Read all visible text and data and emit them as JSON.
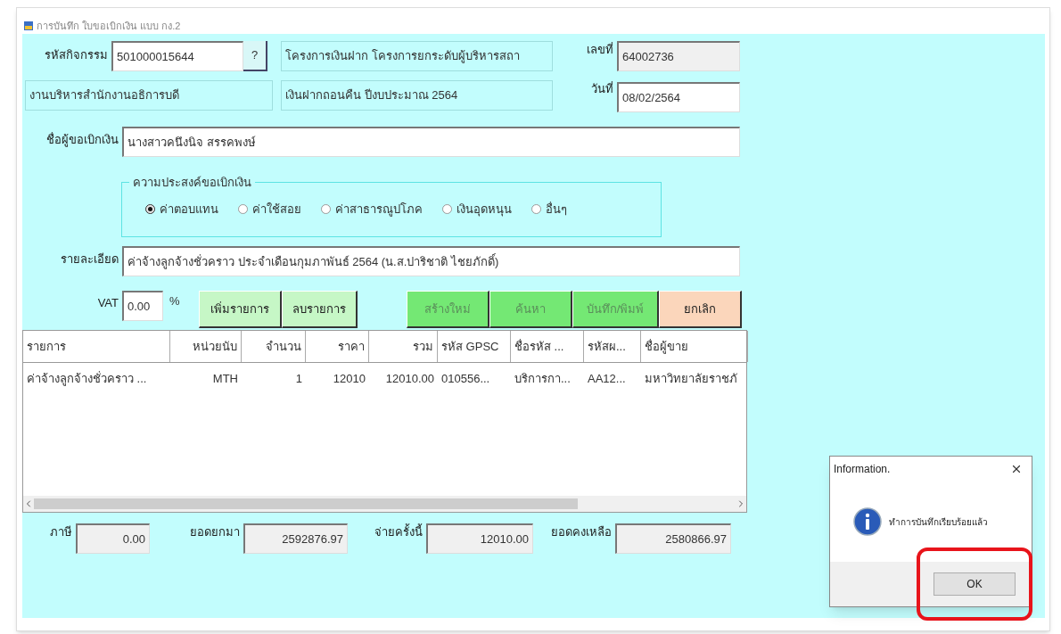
{
  "window": {
    "title": "การบันทึก ใบขอเบิกเงิน แบบ กง.2"
  },
  "header": {
    "activity_label": "รหัสกิจกรรม",
    "activity_code": "501000015644",
    "lookup_button": "?",
    "project": "โครงการเงินฝาก โครงการยกระดับผู้บริหารสถา",
    "number_label": "เลขที่",
    "number": "64002736",
    "department": "งานบริหารสำนักงานอธิการบดี",
    "budget": "เงินฝากถอนคืน ปีงบประมาณ 2564",
    "date_label": "วันที่",
    "date": "08/02/2564"
  },
  "requester": {
    "label": "ชื่อผู้ขอเบิกเงิน",
    "value": "นางสาวคนึงนิจ สรรคพงษ์"
  },
  "purpose": {
    "legend": "ความประสงค์ขอเบิกเงิน",
    "options": [
      {
        "label": "ค่าตอบแทน",
        "selected": true
      },
      {
        "label": "ค่าใช้สอย",
        "selected": false
      },
      {
        "label": "ค่าสาธารณูปโภค",
        "selected": false
      },
      {
        "label": "เงินอุดหนุน",
        "selected": false
      },
      {
        "label": "อื่นๆ",
        "selected": false
      }
    ]
  },
  "detail": {
    "label": "รายละเอียด",
    "value": "ค่าจ้างลูกจ้างชั่วคราว ประจำเดือนกุมภาพันธ์ 2564 (น.ส.ปาริชาติ ไชยภักดิ์)"
  },
  "vat": {
    "label": "VAT",
    "value": "0.00",
    "unit": "%"
  },
  "buttons": [
    {
      "label": "เพิ่มรายการ",
      "kind": "light",
      "disabled": false
    },
    {
      "label": "ลบรายการ",
      "kind": "light",
      "disabled": false
    },
    {
      "label": "สร้างใหม่",
      "kind": "green",
      "disabled": true
    },
    {
      "label": "ค้นหา",
      "kind": "green",
      "disabled": true
    },
    {
      "label": "บันทึก/พิมพ์",
      "kind": "green",
      "disabled": true
    },
    {
      "label": "ยกเลิก",
      "kind": "cancel",
      "disabled": false
    }
  ],
  "table": {
    "columns": [
      {
        "label": "รายการ"
      },
      {
        "label": "หน่วยนับ"
      },
      {
        "label": "จำนวน"
      },
      {
        "label": "ราคา"
      },
      {
        "label": "รวม"
      },
      {
        "label": "รหัส GPSC"
      },
      {
        "label": "ชื่อรหัส ..."
      },
      {
        "label": "รหัสผ..."
      },
      {
        "label": "ชื่อผู้ขาย"
      }
    ],
    "rows": [
      [
        "ค่าจ้างลูกจ้างชั่วคราว ...",
        "MTH",
        "1",
        "12010",
        "12010.00",
        "010556...",
        "บริการกา...",
        "AA12...",
        "มหาวิทยาลัยราชภั"
      ]
    ]
  },
  "totals": [
    {
      "label": "ภาษี",
      "value": "0.00"
    },
    {
      "label": "ยอดยกมา",
      "value": "2592876.97"
    },
    {
      "label": "จ่ายครั้งนี้",
      "value": "12010.00"
    },
    {
      "label": "ยอดคงเหลือ",
      "value": "2580866.97"
    }
  ],
  "dialog": {
    "title": "Information.",
    "message": "ทำการบันทึกเรียบร้อยแล้ว",
    "button": "OK",
    "highlighted": true
  }
}
